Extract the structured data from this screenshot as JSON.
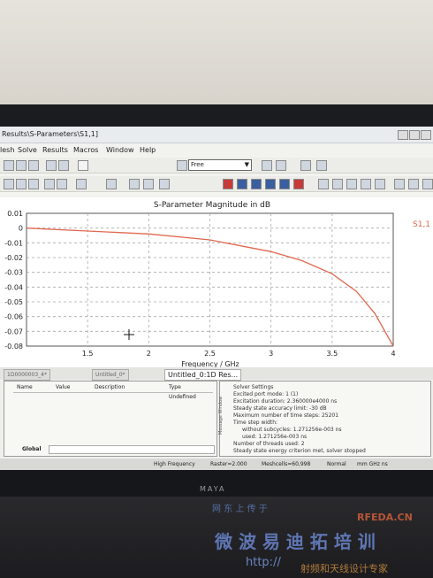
{
  "window": {
    "title": "Results\\S-Parameters\\S1,1]",
    "menus": [
      "lesh",
      "Solve",
      "Results",
      "Macros",
      "Window",
      "Help"
    ],
    "free_combo": "Free"
  },
  "plot": {
    "title": "S-Parameter Magnitude in dB",
    "legend": "S1,1",
    "xlabel": "Frequency / GHz"
  },
  "chart_data": {
    "type": "line",
    "title": "S-Parameter Magnitude in dB",
    "xlabel": "Frequency / GHz",
    "ylabel": "",
    "xlim": [
      1,
      4
    ],
    "ylim": [
      -0.08,
      0.01
    ],
    "x_ticks": [
      "1.5",
      "2",
      "2.5",
      "3",
      "3.5",
      "4"
    ],
    "y_ticks": [
      "0.01",
      "0",
      "-0.01",
      "-0.02",
      "-0.03",
      "-0.04",
      "-0.05",
      "-0.06",
      "-0.07",
      "-0.08"
    ],
    "grid": true,
    "series": [
      {
        "name": "S1,1",
        "color": "#e0684f",
        "x": [
          1.0,
          1.5,
          2.0,
          2.5,
          3.0,
          3.25,
          3.5,
          3.7,
          3.85,
          4.0
        ],
        "y": [
          0.0,
          -0.002,
          -0.004,
          -0.008,
          -0.016,
          -0.022,
          -0.031,
          -0.043,
          -0.058,
          -0.08
        ]
      }
    ]
  },
  "tabs": [
    "1D0000003_4*",
    "Untitled_0*",
    "Untitled_0:1D Res..."
  ],
  "params": {
    "headers": [
      "Name",
      "Value",
      "Description",
      "Type"
    ],
    "row_type": "Undefined",
    "global_label": "Global"
  },
  "messages": [
    "Solver Settings",
    "Excited port mode: 1 (1)",
    "Excitation duration: 2.360000e4000 ns",
    "Steady state accuracy limit: -30 dB",
    "Maximum number of time steps: 25201",
    "Time step width:",
    "without subcycles: 1.271256e-003 ns",
    "used: 1.271256e-003 ns",
    "Number of threads used: 2",
    "Steady state energy criterion met, solver stopped"
  ],
  "side_label": "Message Window",
  "status": {
    "mode": "High Frequency",
    "raster": "Raster=2.000",
    "meshcells": "Meshcells=60,998",
    "normal": "Normal",
    "units": "mm  GHz  ns"
  },
  "monitor_brand": "MAYA",
  "watermark": {
    "line1": "网  东  上  传  于",
    "site": "RFEDA.CN",
    "big": "微  波    易  迪  拓  培  训",
    "url": "http://",
    "slogan": "射频和天线设计专家"
  },
  "colors": {
    "curve": "#e0684f",
    "grid": "#a9a9a9",
    "legend": "#e0684f"
  }
}
